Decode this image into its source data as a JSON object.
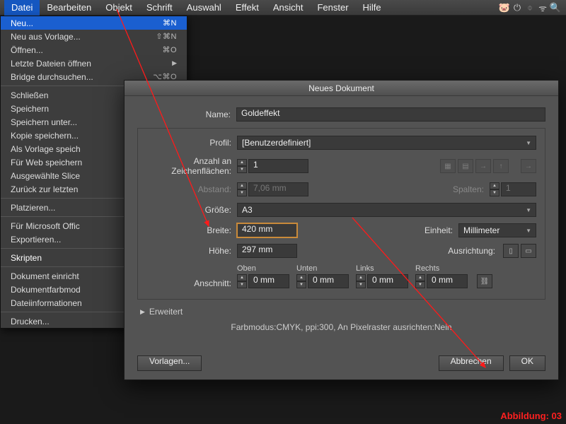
{
  "menubar": {
    "items": [
      "Datei",
      "Bearbeiten",
      "Objekt",
      "Schrift",
      "Auswahl",
      "Effekt",
      "Ansicht",
      "Fenster",
      "Hilfe"
    ]
  },
  "dropdown": {
    "groups": [
      [
        {
          "label": "Neu...",
          "accel": "⌘N",
          "hl": true
        },
        {
          "label": "Neu aus Vorlage...",
          "accel": "⇧⌘N"
        },
        {
          "label": "Öffnen...",
          "accel": "⌘O"
        },
        {
          "label": "Letzte Dateien öffnen",
          "accel": "▶",
          "submenu": true
        },
        {
          "label": "Bridge durchsuchen...",
          "accel": "⌥⌘O"
        }
      ],
      [
        {
          "label": "Schließen"
        },
        {
          "label": "Speichern"
        },
        {
          "label": "Speichern unter..."
        },
        {
          "label": "Kopie speichern..."
        },
        {
          "label": "Als Vorlage speich"
        },
        {
          "label": "Für Web speichern"
        },
        {
          "label": "Ausgewählte Slice"
        },
        {
          "label": "Zurück zur letzten"
        }
      ],
      [
        {
          "label": "Platzieren..."
        }
      ],
      [
        {
          "label": "Für Microsoft Offic"
        },
        {
          "label": "Exportieren..."
        }
      ],
      [
        {
          "label": "Skripten",
          "bold": true
        }
      ],
      [
        {
          "label": "Dokument einricht"
        },
        {
          "label": "Dokumentfarbmod"
        },
        {
          "label": "Dateiinformationen"
        }
      ],
      [
        {
          "label": "Drucken..."
        }
      ]
    ]
  },
  "dialog": {
    "title": "Neues Dokument",
    "name_label": "Name:",
    "name_value": "Goldeffekt",
    "profile_label": "Profil:",
    "profile_value": "[Benutzerdefiniert]",
    "artboards_label": "Anzahl an Zeichenflächen:",
    "artboards_value": "1",
    "spacing_label": "Abstand:",
    "spacing_value": "7,06 mm",
    "columns_label": "Spalten:",
    "columns_value": "1",
    "size_label": "Größe:",
    "size_value": "A3",
    "width_label": "Breite:",
    "width_value": "420 mm",
    "units_label": "Einheit:",
    "units_value": "Millimeter",
    "height_label": "Höhe:",
    "height_value": "297 mm",
    "orient_label": "Ausrichtung:",
    "bleed_label": "Anschnitt:",
    "bleed_top": "Oben",
    "bleed_bottom": "Unten",
    "bleed_left": "Links",
    "bleed_right": "Rechts",
    "bleed_val": "0 mm",
    "advanced": "Erweitert",
    "summary": "Farbmodus:CMYK, ppi:300, An Pixelraster ausrichten:Nein",
    "templates_btn": "Vorlagen...",
    "cancel_btn": "Abbrechen",
    "ok_btn": "OK"
  },
  "caption": "Abbildung: 03"
}
